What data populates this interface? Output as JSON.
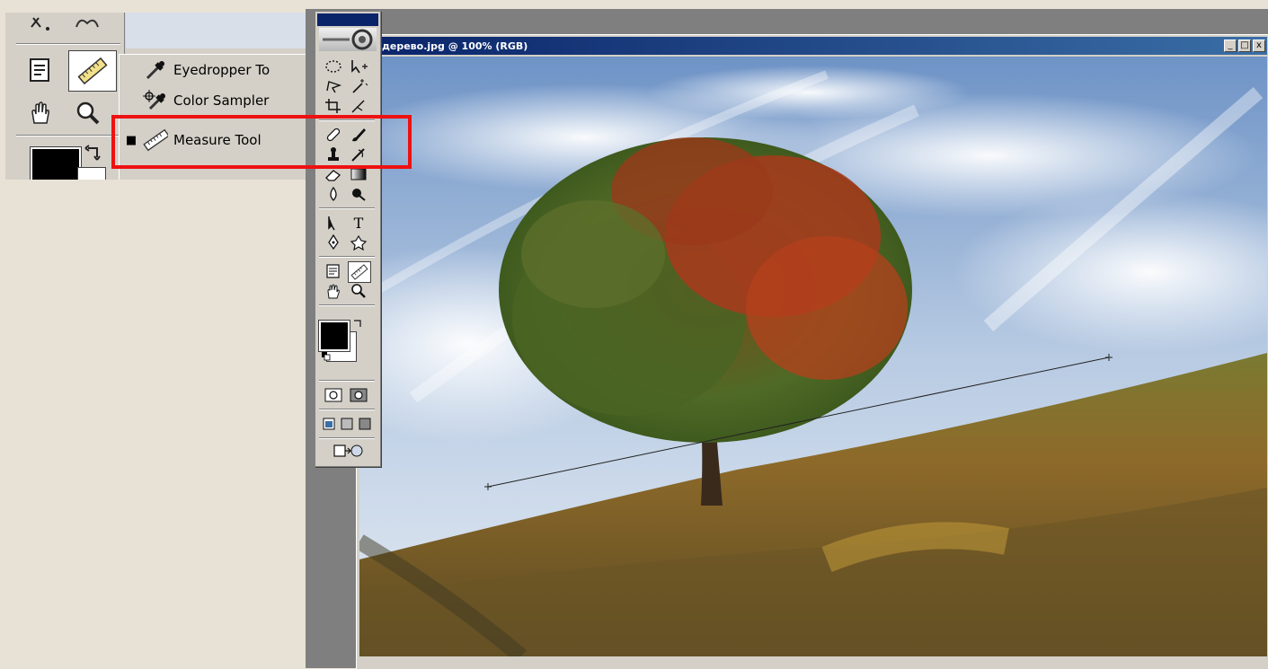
{
  "document": {
    "title": "дерево.jpg @ 100% (RGB)",
    "window_buttons": [
      "_",
      "□",
      "x"
    ]
  },
  "flyout": {
    "items": [
      {
        "label": "Eyedropper To",
        "icon": "eyedropper-icon",
        "selected": false
      },
      {
        "label": "Color Sampler",
        "icon": "color-sampler-icon",
        "selected": false
      },
      {
        "label": "Measure Tool",
        "icon": "measure-tool-icon",
        "selected": true
      }
    ],
    "selected_marker": "■"
  },
  "toolbox": {
    "type_tool_glyph": "T"
  },
  "colors": {
    "highlight": "#ee1111",
    "titlebar": "#0a246a",
    "workspace": "#7f7f7f",
    "ui_face": "#d4d0c8"
  }
}
